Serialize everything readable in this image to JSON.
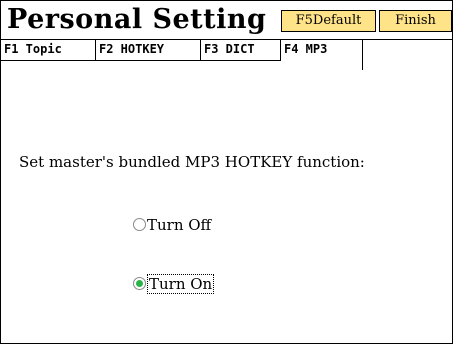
{
  "header": {
    "title": "Personal Setting",
    "default_button": "F5Default",
    "finish_button": "Finish"
  },
  "tabs": [
    {
      "label": "F1 Topic"
    },
    {
      "label": "F2 HOTKEY"
    },
    {
      "label": "F3 DICT"
    },
    {
      "label": "F4 MP3",
      "active": true
    }
  ],
  "content": {
    "prompt": "Set master's bundled MP3 HOTKEY function:",
    "options": [
      {
        "label": "Turn Off",
        "selected": false
      },
      {
        "label": "Turn On",
        "selected": true
      }
    ],
    "radio_color": "#2ab34a"
  },
  "colors": {
    "button_bg": "#ffe389"
  }
}
